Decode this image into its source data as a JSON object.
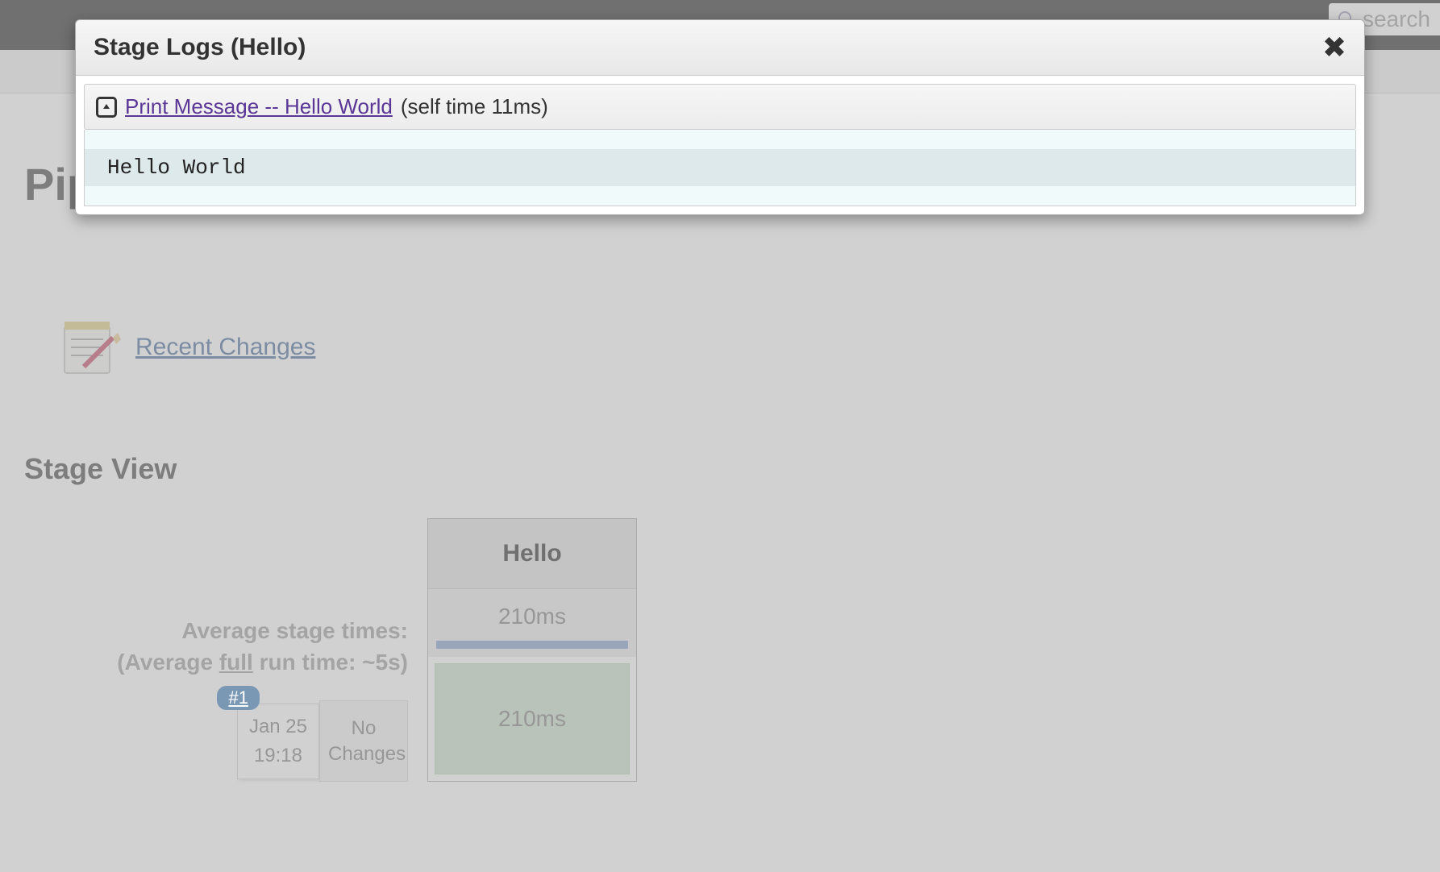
{
  "search": {
    "placeholder": "search"
  },
  "page": {
    "title_partial": "Pipel"
  },
  "recent_changes": {
    "label": "Recent Changes"
  },
  "stage_view": {
    "title": "Stage View",
    "avg_label": "Average stage times:",
    "avg_sub_prefix": "(Average ",
    "avg_sub_full": "full",
    "avg_sub_suffix": " run time: ~5s)",
    "build_badge": "#1",
    "date_month": "Jan 25",
    "date_time": "19:18",
    "changes_label": "No\nChanges",
    "stages": [
      {
        "name": "Hello",
        "avg": "210ms",
        "run": "210ms"
      }
    ]
  },
  "modal": {
    "title": "Stage Logs (Hello)",
    "step_link": "Print Message -- Hello World ",
    "step_time": "(self time 11ms)",
    "log_line": "Hello World"
  }
}
